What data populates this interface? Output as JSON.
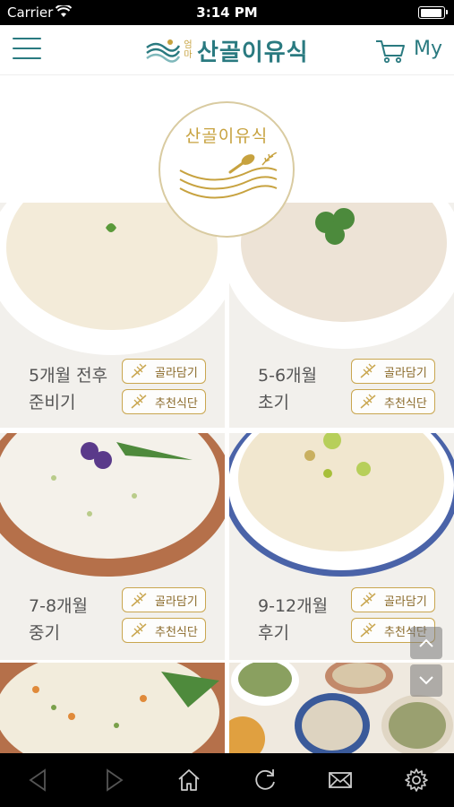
{
  "status_bar": {
    "carrier": "Carrier",
    "time": "3:14 PM"
  },
  "header": {
    "brand_small": "엄마",
    "brand_name": "산골이유식",
    "my_label": "My"
  },
  "logo": {
    "text": "산골이유식"
  },
  "cards": [
    {
      "age": "5개월 전후",
      "stage": "준비기",
      "pick_label": "골라담기",
      "menu_label": "추천식단"
    },
    {
      "age": "5-6개월",
      "stage": "초기",
      "pick_label": "골라담기",
      "menu_label": "추천식단"
    },
    {
      "age": "7-8개월",
      "stage": "중기",
      "pick_label": "골라담기",
      "menu_label": "추천식단"
    },
    {
      "age": "9-12개월",
      "stage": "후기",
      "pick_label": "골라담기",
      "menu_label": "추천식단"
    }
  ],
  "colors": {
    "brand_teal": "#2a7a80",
    "brand_gold": "#c7a23f",
    "pill_border": "#c9a64f"
  },
  "icons": {
    "toolbar": [
      "back-arrow-icon",
      "forward-arrow-icon",
      "home-icon",
      "refresh-icon",
      "mail-icon",
      "settings-icon"
    ]
  }
}
